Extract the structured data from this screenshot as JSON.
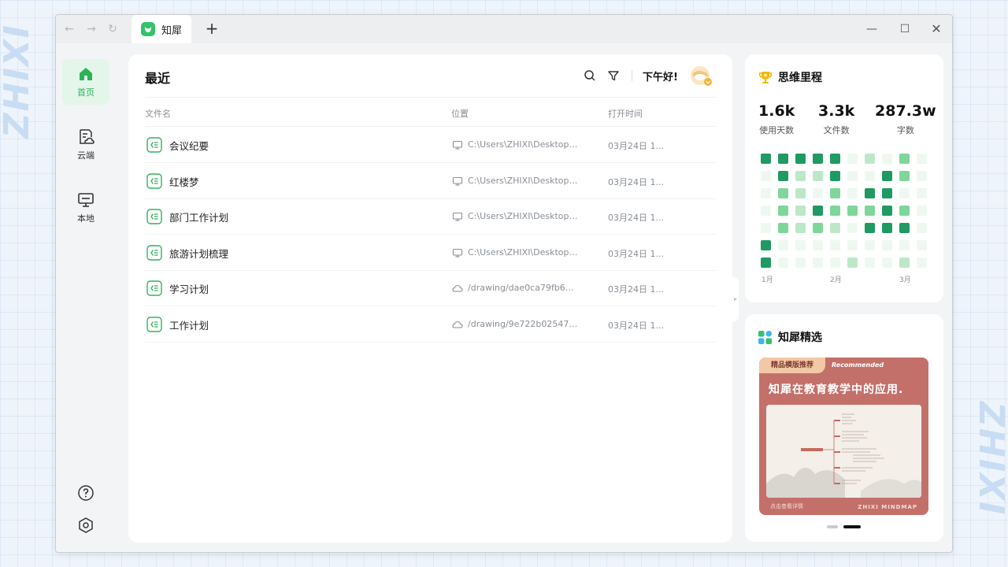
{
  "background": {
    "watermark": "ZHIXI"
  },
  "titlebar": {
    "tab_title": "知犀",
    "add_tab": "+",
    "back": "←",
    "forward": "→",
    "reload": "↻",
    "minimize": "—",
    "maximize": "☐",
    "close": "✕"
  },
  "sidebar": {
    "items": [
      {
        "label": "首页",
        "icon": "home-icon",
        "active": true
      },
      {
        "label": "云端",
        "icon": "cloud-file-icon",
        "active": false
      },
      {
        "label": "本地",
        "icon": "monitor-icon",
        "active": false
      }
    ]
  },
  "main": {
    "title": "最近",
    "greeting": "下午好!",
    "columns": {
      "name": "文件名",
      "location": "位置",
      "time": "打开时间"
    },
    "files": [
      {
        "name": "会议纪要",
        "loc_type": "local",
        "location": "C:\\Users\\ZHIXI\\Desktop\\...",
        "time": "03月24日 1..."
      },
      {
        "name": "红楼梦",
        "loc_type": "local",
        "location": "C:\\Users\\ZHIXI\\Desktop\\...",
        "time": "03月24日 1..."
      },
      {
        "name": "部门工作计划",
        "loc_type": "local",
        "location": "C:\\Users\\ZHIXI\\Desktop\\...",
        "time": "03月24日 1..."
      },
      {
        "name": "旅游计划梳理",
        "loc_type": "local",
        "location": "C:\\Users\\ZHIXI\\Desktop\\...",
        "time": "03月24日 1..."
      },
      {
        "name": "学习计划",
        "loc_type": "cloud",
        "location": "/drawing/dae0ca79fb64fd5...",
        "time": "03月24日 1..."
      },
      {
        "name": "工作计划",
        "loc_type": "cloud",
        "location": "/drawing/9e722b02547ee1...",
        "time": "03月24日 1..."
      }
    ]
  },
  "stats": {
    "title": "思维里程",
    "items": [
      {
        "value": "1.6k",
        "label": "使用天数"
      },
      {
        "value": "3.3k",
        "label": "文件数"
      },
      {
        "value": "287.3w",
        "label": "字数"
      }
    ],
    "months": [
      "1月",
      "2月",
      "3月"
    ],
    "heatmap_levels": [
      [
        4,
        4,
        4,
        4,
        4,
        1,
        2,
        1,
        3,
        1
      ],
      [
        1,
        4,
        2,
        2,
        4,
        1,
        1,
        4,
        3,
        1
      ],
      [
        1,
        3,
        2,
        1,
        3,
        1,
        4,
        4,
        1,
        1
      ],
      [
        1,
        3,
        2,
        4,
        3,
        3,
        3,
        4,
        3,
        1
      ],
      [
        1,
        3,
        2,
        3,
        2,
        1,
        4,
        4,
        4,
        1
      ],
      [
        4,
        1,
        1,
        1,
        1,
        1,
        1,
        1,
        1,
        1
      ],
      [
        4,
        1,
        1,
        1,
        1,
        2,
        1,
        1,
        2,
        1
      ]
    ],
    "heatmap_colors": [
      "#eef8f1",
      "#bde8c8",
      "#7fd69a",
      "#1f9a63"
    ]
  },
  "featured": {
    "title": "知犀精选",
    "banner": {
      "tag": "精品模版推荐",
      "tag_en": "Recommended",
      "title": "知犀在教育教学中的应用.",
      "footer_left": "点击查看详情",
      "footer_right": "ZHIXI MINDMAP"
    }
  }
}
